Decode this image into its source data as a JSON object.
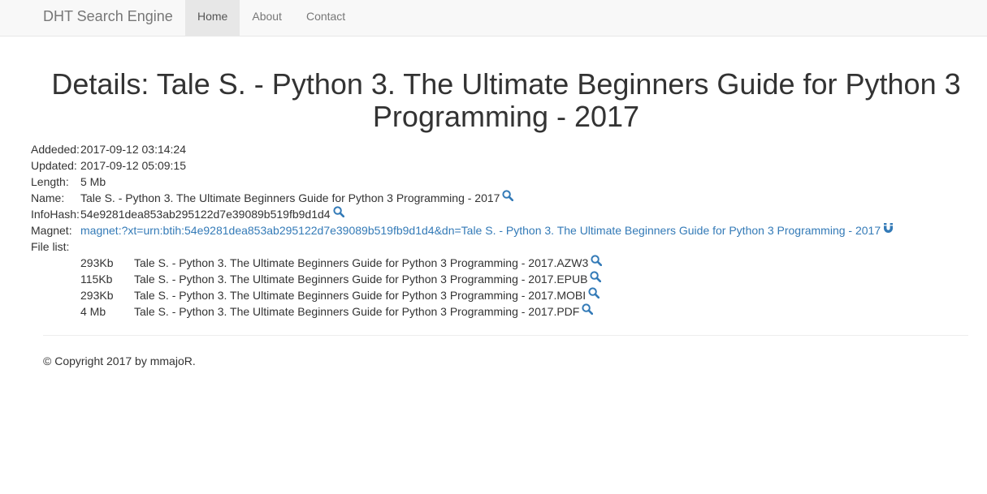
{
  "nav": {
    "brand": "DHT Search Engine",
    "items": [
      {
        "label": "Home",
        "active": true
      },
      {
        "label": "About",
        "active": false
      },
      {
        "label": "Contact",
        "active": false
      }
    ]
  },
  "title": "Details: Tale S. - Python 3. The Ultimate Beginners Guide for Python 3 Programming - 2017",
  "details": {
    "added_label": "Addeded:",
    "added_value": "2017-09-12 03:14:24",
    "updated_label": "Updated:",
    "updated_value": "2017-09-12 05:09:15",
    "length_label": "Length:",
    "length_value": "5 Mb",
    "name_label": "Name:",
    "name_value": "Tale S. - Python 3. The Ultimate Beginners Guide for Python 3 Programming - 2017",
    "infohash_label": "InfoHash:",
    "infohash_value": "54e9281dea853ab295122d7e39089b519fb9d1d4",
    "magnet_label": "Magnet:",
    "magnet_value": "magnet:?xt=urn:btih:54e9281dea853ab295122d7e39089b519fb9d1d4&dn=Tale S. - Python 3. The Ultimate Beginners Guide for Python 3 Programming - 2017",
    "filelist_label": "File list:"
  },
  "files": [
    {
      "size": "293Kb",
      "name": "Tale S. - Python 3. The Ultimate Beginners Guide for Python 3 Programming - 2017.AZW3"
    },
    {
      "size": "115Kb",
      "name": "Tale S. - Python 3. The Ultimate Beginners Guide for Python 3 Programming - 2017.EPUB"
    },
    {
      "size": "293Kb",
      "name": "Tale S. - Python 3. The Ultimate Beginners Guide for Python 3 Programming - 2017.MOBI"
    },
    {
      "size": "4 Mb",
      "name": "Tale S. - Python 3. The Ultimate Beginners Guide for Python 3 Programming - 2017.PDF"
    }
  ],
  "icons": {
    "search": "search-icon",
    "magnet": "magnet-icon"
  },
  "colors": {
    "link": "#337ab7",
    "navbar_bg": "#f8f8f8",
    "nav_active_bg": "#e7e7e7"
  },
  "footer": {
    "copyright": "© Copyright 2017 by mmajoR."
  }
}
